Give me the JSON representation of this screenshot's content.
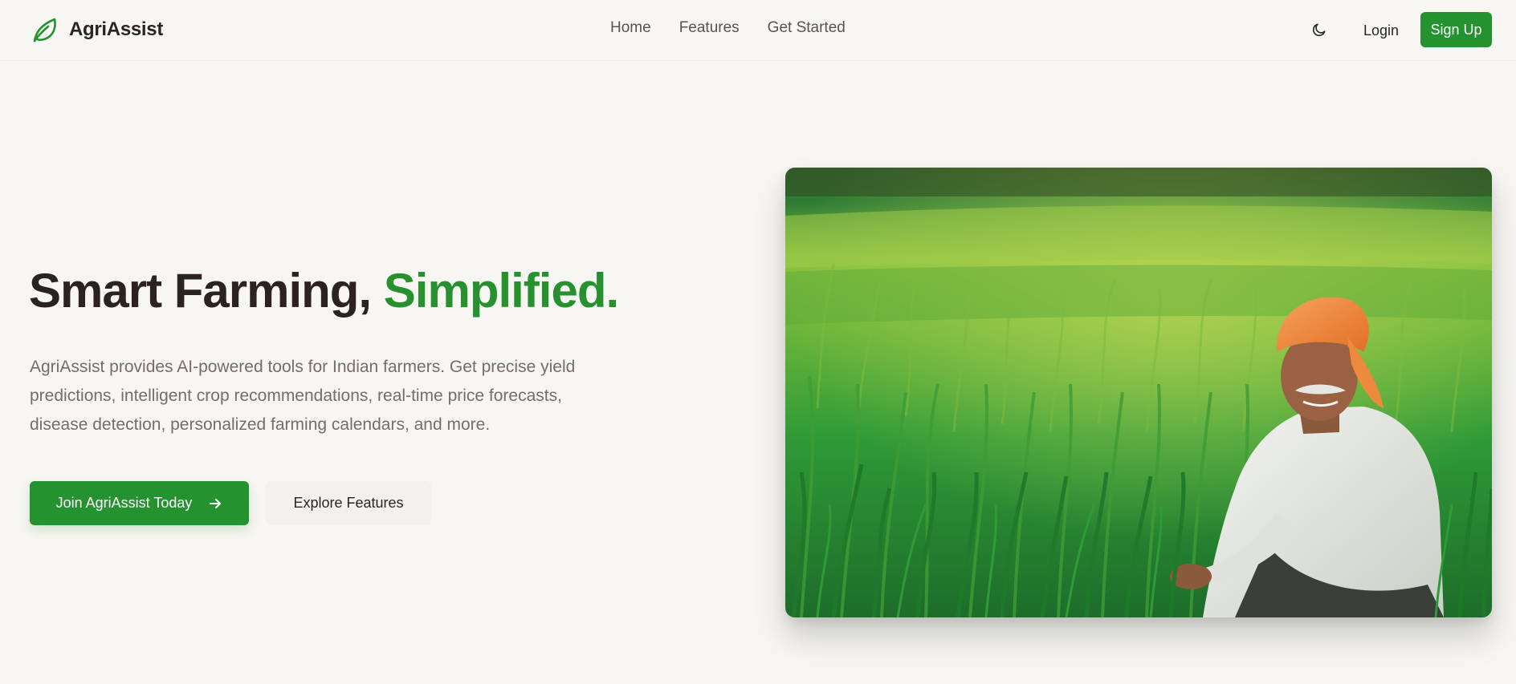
{
  "brand": {
    "name": "AgriAssist",
    "icon": "leaf-icon"
  },
  "nav": {
    "links": [
      {
        "label": "Home"
      },
      {
        "label": "Features"
      },
      {
        "label": "Get Started"
      }
    ],
    "theme_toggle_icon": "moon-icon",
    "login_label": "Login",
    "signup_label": "Sign Up"
  },
  "hero": {
    "title_main": "Smart Farming, ",
    "title_accent": "Simplified.",
    "description": "AgriAssist provides AI-powered tools for Indian farmers. Get precise yield predictions, intelligent crop recommendations, real-time price forecasts, disease detection, personalized farming calendars, and more.",
    "primary_cta": {
      "label": "Join AgriAssist Today",
      "icon": "arrow-right-icon"
    },
    "secondary_cta": {
      "label": "Explore Features"
    },
    "image": {
      "subject": "farmer-in-wheat-field"
    }
  },
  "colors": {
    "accent": "#23922f",
    "accent_text": "#27902f",
    "background": "#f7f6f2",
    "heading": "#2a2321",
    "body_text": "#766d69"
  }
}
